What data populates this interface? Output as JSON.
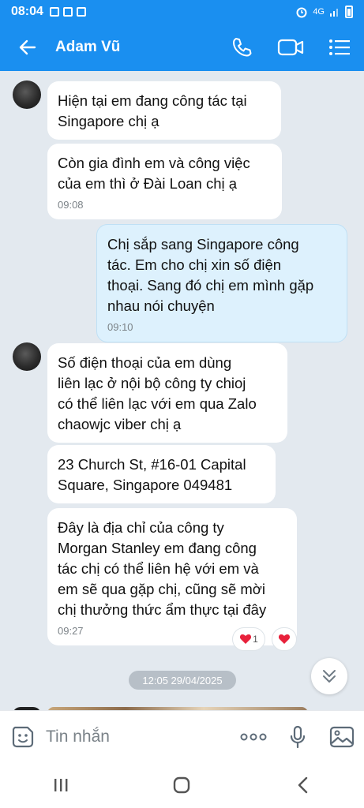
{
  "status_bar": {
    "time": "08:04",
    "network": "4G"
  },
  "header": {
    "contact_name": "Adam Vũ"
  },
  "messages": [
    {
      "text": "Hiện tại em đang công tác tại\nSingapore chị ạ",
      "time": ""
    },
    {
      "text": "Còn gia đình em và công việc\ncủa em thì ở Đài Loan chị ạ",
      "time": "09:08"
    },
    {
      "text": "Chị sắp sang Singapore công\ntác. Em cho chị xin số điện\nthoại. Sang đó chị em mình gặp\nnhau nói chuyện",
      "time": "09:10"
    },
    {
      "text": "Số điện thoại của em dùng\nliên lạc ở nội bộ công ty chioj\ncó thể liên lạc với em qua Zalo\nchaowjc viber chị ạ",
      "time": ""
    },
    {
      "text": "23 Church St, #16-01 Capital\nSquare, Singapore 049481",
      "time": ""
    },
    {
      "text": "Đây là địa chỉ của công ty\nMorgan Stanley em đang công\ntác chị có thể liên hệ với em và\nem sẽ qua gặp chị, cũng sẽ mời\nchị thưởng thức ẩm thực tại đây",
      "time": "09:27"
    }
  ],
  "reaction": {
    "count": "1",
    "color": "#e8213b"
  },
  "date_separator": "12:05 29/04/2025",
  "composer": {
    "placeholder": "Tin nhắn"
  },
  "colors": {
    "brand": "#1a8ff0",
    "my_bubble": "#ddf1fd",
    "chat_bg": "#e3e9ef"
  },
  "icons": [
    "back-arrow-icon",
    "phone-icon",
    "video-call-icon",
    "menu-list-icon",
    "emoji-sticker-icon",
    "more-icon",
    "microphone-icon",
    "image-icon",
    "chevron-double-down-icon",
    "heart-icon"
  ]
}
